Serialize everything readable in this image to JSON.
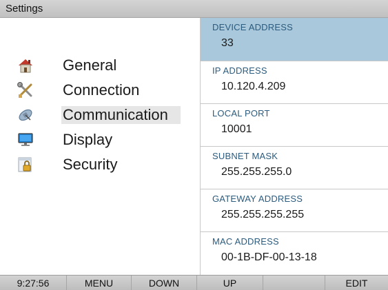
{
  "title": "Settings",
  "menu": {
    "items": [
      {
        "label": "General",
        "icon": "house-icon",
        "selected": false
      },
      {
        "label": "Connection",
        "icon": "tools-icon",
        "selected": false
      },
      {
        "label": "Communication",
        "icon": "satellite-icon",
        "selected": true
      },
      {
        "label": "Display",
        "icon": "monitor-icon",
        "selected": false
      },
      {
        "label": "Security",
        "icon": "lock-icon",
        "selected": false
      }
    ]
  },
  "fields": [
    {
      "label": "DEVICE ADDRESS",
      "value": "33",
      "selected": true
    },
    {
      "label": "IP ADDRESS",
      "value": "10.120.4.209",
      "selected": false
    },
    {
      "label": "LOCAL PORT",
      "value": "10001",
      "selected": false
    },
    {
      "label": "SUBNET MASK",
      "value": "255.255.255.0",
      "selected": false
    },
    {
      "label": "GATEWAY ADDRESS",
      "value": "255.255.255.255",
      "selected": false
    },
    {
      "label": "MAC ADDRESS",
      "value": "00-1B-DF-00-13-18",
      "selected": false
    }
  ],
  "statusbar": {
    "time": "9:27:56",
    "menu": "MENU",
    "down": "DOWN",
    "up": "UP",
    "blank": "",
    "edit": "EDIT"
  },
  "colors": {
    "selected_field": "#a9c8db",
    "field_label": "#2b5b7e",
    "selected_menu": "#e6e6e6"
  }
}
